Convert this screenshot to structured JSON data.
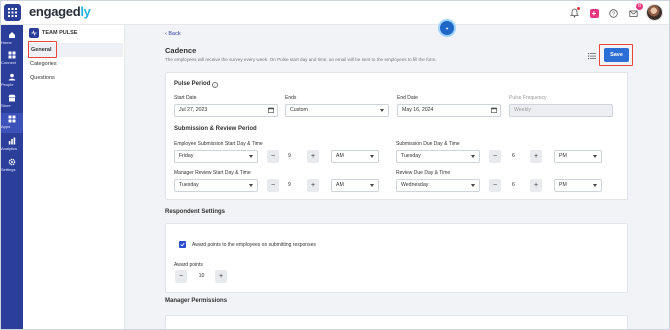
{
  "brand": {
    "logo_main": "engaged",
    "logo_accent": "ly"
  },
  "topbar": {
    "inbox_badge": "8"
  },
  "leftnav": {
    "items": [
      {
        "label": "Home"
      },
      {
        "label": "Connect"
      },
      {
        "label": "People"
      },
      {
        "label": "Store"
      },
      {
        "label": "Apps"
      },
      {
        "label": "Analytics"
      },
      {
        "label": "Settings"
      }
    ]
  },
  "subnav": {
    "title": "TEAM PULSE",
    "items": [
      {
        "label": "General"
      },
      {
        "label": "Categories"
      },
      {
        "label": "Questions"
      }
    ]
  },
  "header": {
    "back_label": "Back",
    "title": "Cadence",
    "description": "The employees will receive the survey every week. On Pulse start day and time, an email will be sent to the employees to fill the form.",
    "save_label": "Save"
  },
  "pulse_period": {
    "title": "Pulse Period",
    "start_date_label": "Start Date",
    "start_date_value": "Jul 27, 2023",
    "ends_label": "Ends",
    "ends_value": "Custom",
    "end_date_label": "End Date",
    "end_date_value": "May 16, 2024",
    "frequency_label": "Pulse Frequency",
    "frequency_value": "Weekly"
  },
  "submission": {
    "title": "Submission & Review Period",
    "emp_start_label": "Employee Submission Start Day & Time",
    "emp_start_day": "Friday",
    "emp_start_hour": "9",
    "emp_start_ampm": "AM",
    "sub_due_label": "Submission Due Day & Time",
    "sub_due_day": "Tuesday",
    "sub_due_hour": "6",
    "sub_due_ampm": "PM",
    "mgr_start_label": "Manager Review Start Day & Time",
    "mgr_start_day": "Tuesday",
    "mgr_start_hour": "9",
    "mgr_start_ampm": "AM",
    "rev_due_label": "Review Due Day & Time",
    "rev_due_day": "Wednesday",
    "rev_due_hour": "6",
    "rev_due_ampm": "PM"
  },
  "respondent": {
    "title": "Respondent Settings",
    "award_checkbox_label": "Award points to the employees on submitting responses",
    "award_points_label": "Award points",
    "award_points_value": "10"
  },
  "manager_permissions": {
    "title": "Manager Permissions"
  },
  "steppers": {
    "minus": "−",
    "plus": "+"
  }
}
